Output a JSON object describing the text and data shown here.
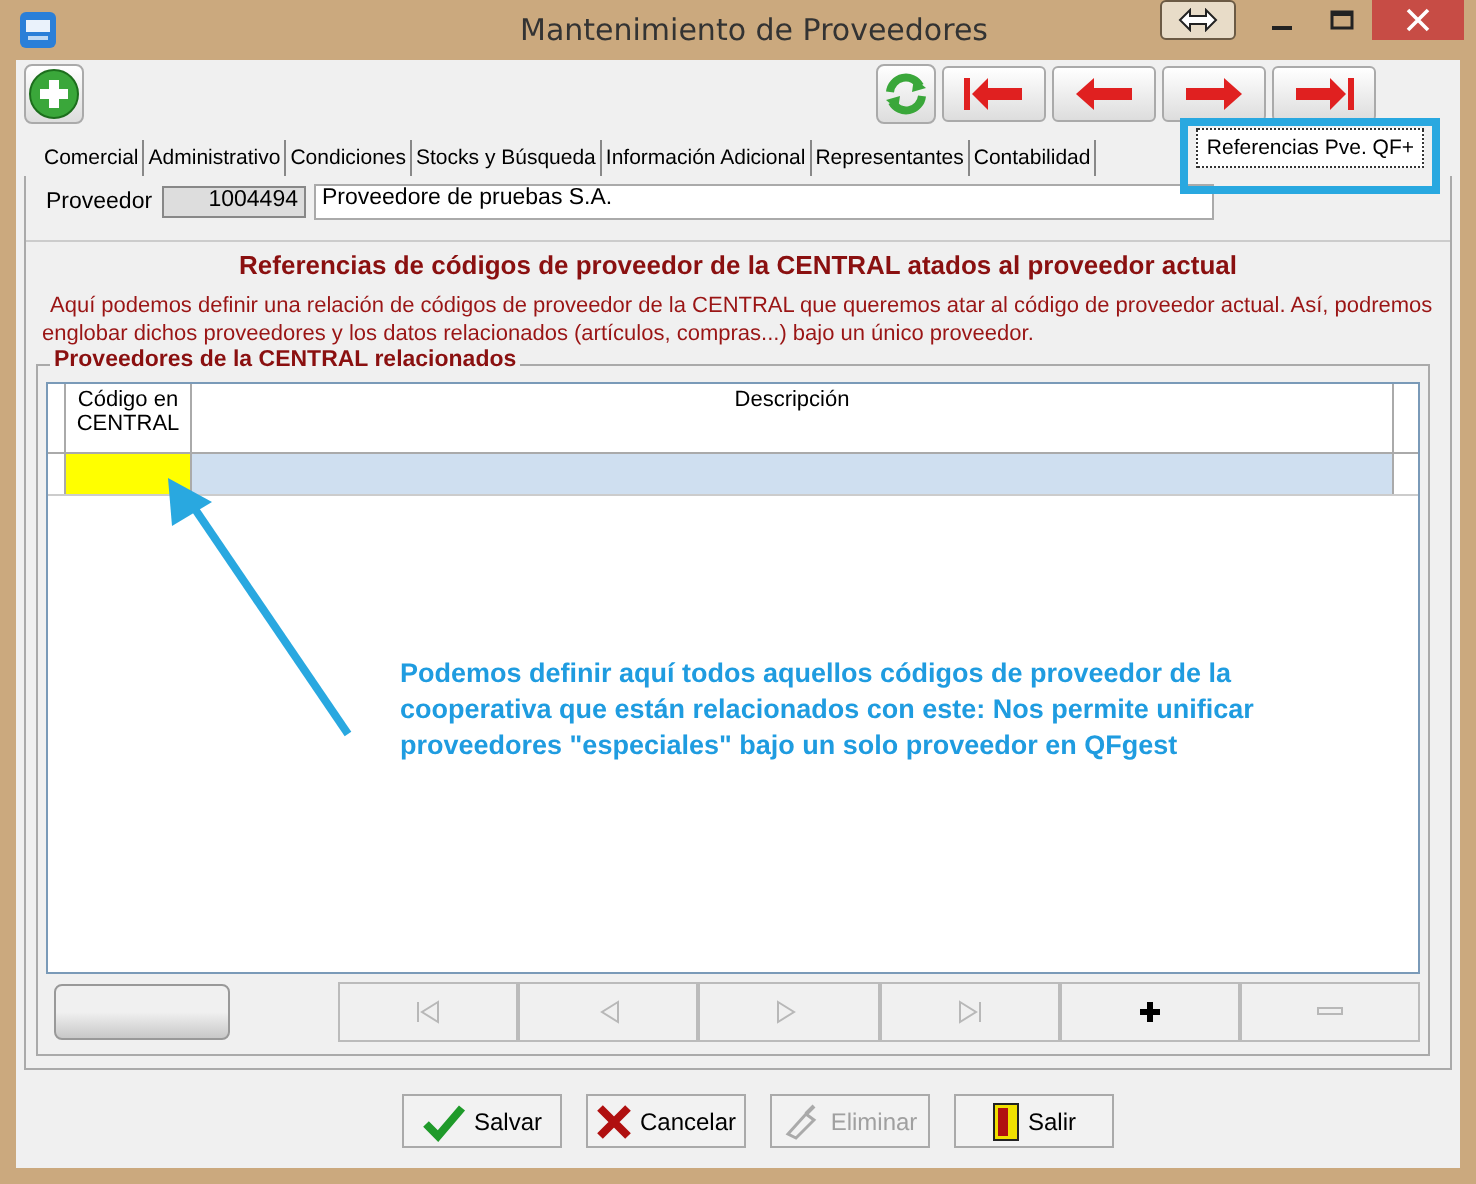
{
  "window": {
    "title": "Mantenimiento de Proveedores"
  },
  "tabs": [
    {
      "label": "Comercial",
      "selected": false
    },
    {
      "label": "Administrativo",
      "selected": false
    },
    {
      "label": "Condiciones",
      "selected": false
    },
    {
      "label": "Stocks y Búsqueda",
      "selected": false
    },
    {
      "label": "Información Adicional",
      "selected": false
    },
    {
      "label": "Representantes",
      "selected": false
    },
    {
      "label": "Contabilidad",
      "selected": false
    },
    {
      "label": "Referencias Pve. QF+",
      "selected": true
    }
  ],
  "proveedor": {
    "label": "Proveedor",
    "code": "1004494",
    "name": "Proveedore de pruebas S.A."
  },
  "section": {
    "title": "Referencias de códigos de proveedor de la CENTRAL atados al proveedor actual",
    "description": "Aquí podemos definir una relación de códigos de proveedor de la CENTRAL que queremos atar al código de proveedor actual. Así, podremos englobar dichos proveedores y los datos relacionados (artículos, compras...) bajo un único proveedor."
  },
  "group": {
    "title": "Proveedores de la CENTRAL relacionados",
    "columns": [
      "Código en CENTRAL",
      "Descripción"
    ]
  },
  "grid_nav": [
    {
      "kind": "first",
      "disabled": true
    },
    {
      "kind": "prev",
      "disabled": true
    },
    {
      "kind": "next",
      "disabled": true
    },
    {
      "kind": "last",
      "disabled": true
    },
    {
      "kind": "add",
      "disabled": false
    },
    {
      "kind": "remove",
      "disabled": true
    }
  ],
  "annotation": {
    "text": "Podemos definir aquí todos aquellos códigos de proveedor de la cooperativa que están relacionados con este: Nos permite unificar proveedores \"especiales\" bajo un solo proveedor en QFgest"
  },
  "buttons": [
    {
      "label": "Salvar",
      "kind": "save",
      "disabled": false
    },
    {
      "label": "Cancelar",
      "kind": "cancel",
      "disabled": false
    },
    {
      "label": "Eliminar",
      "kind": "delete",
      "disabled": true
    },
    {
      "label": "Salir",
      "kind": "exit",
      "disabled": false
    }
  ]
}
